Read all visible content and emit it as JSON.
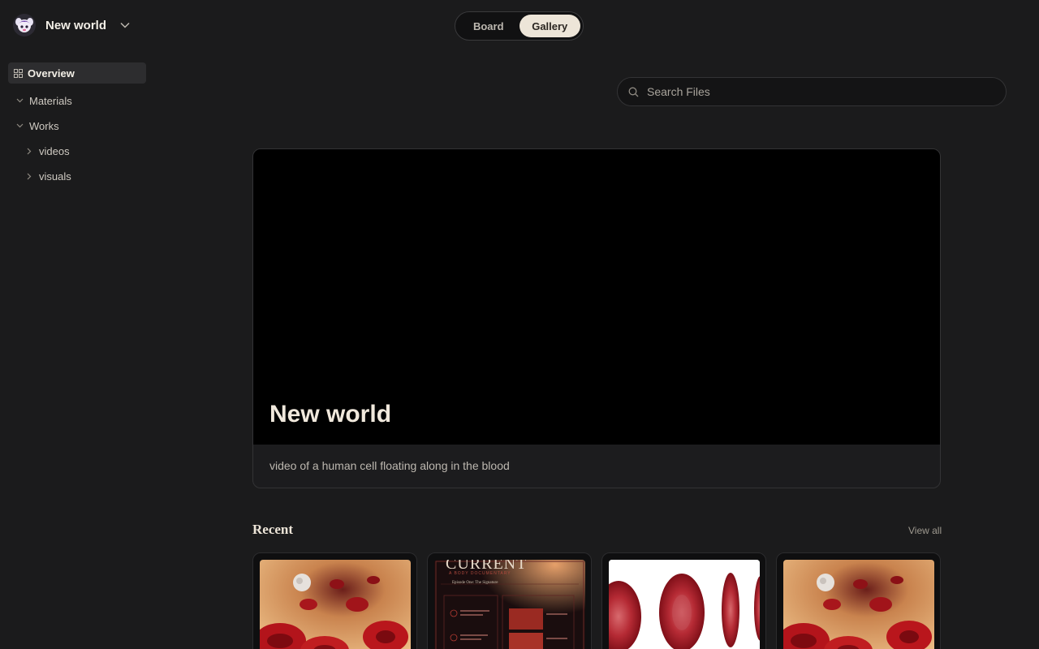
{
  "workspace": {
    "name": "New world",
    "logo_icon": "mascot-icon"
  },
  "sidebar": {
    "overview": "Overview",
    "items": [
      {
        "label": "Materials",
        "level": 1,
        "expanded": true
      },
      {
        "label": "Works",
        "level": 1,
        "expanded": true
      },
      {
        "label": "videos",
        "level": 2,
        "expanded": false
      },
      {
        "label": "visuals",
        "level": 2,
        "expanded": false
      }
    ]
  },
  "view_toggle": {
    "board": "Board",
    "gallery": "Gallery",
    "active": "Gallery"
  },
  "search": {
    "placeholder": "Search Files",
    "value": ""
  },
  "hero": {
    "title": "New world",
    "description": "video of a human cell floating along in the blood"
  },
  "recent": {
    "title": "Recent",
    "view_all": "View all",
    "cards": [
      {
        "kind": "image",
        "subject": "blood-vessel-cells"
      },
      {
        "kind": "document",
        "subject": "poster",
        "heading": "CURRENT",
        "subheading": "A BODY DOCUMENTARY",
        "episode": "Episode One: The Signature"
      },
      {
        "kind": "image",
        "subject": "red-blood-cells-white"
      },
      {
        "kind": "image",
        "subject": "blood-vessel-cells"
      }
    ]
  },
  "colors": {
    "background": "#1b1b1c",
    "accent": "#ede5d8",
    "active_nav": "#2d2d2f"
  }
}
